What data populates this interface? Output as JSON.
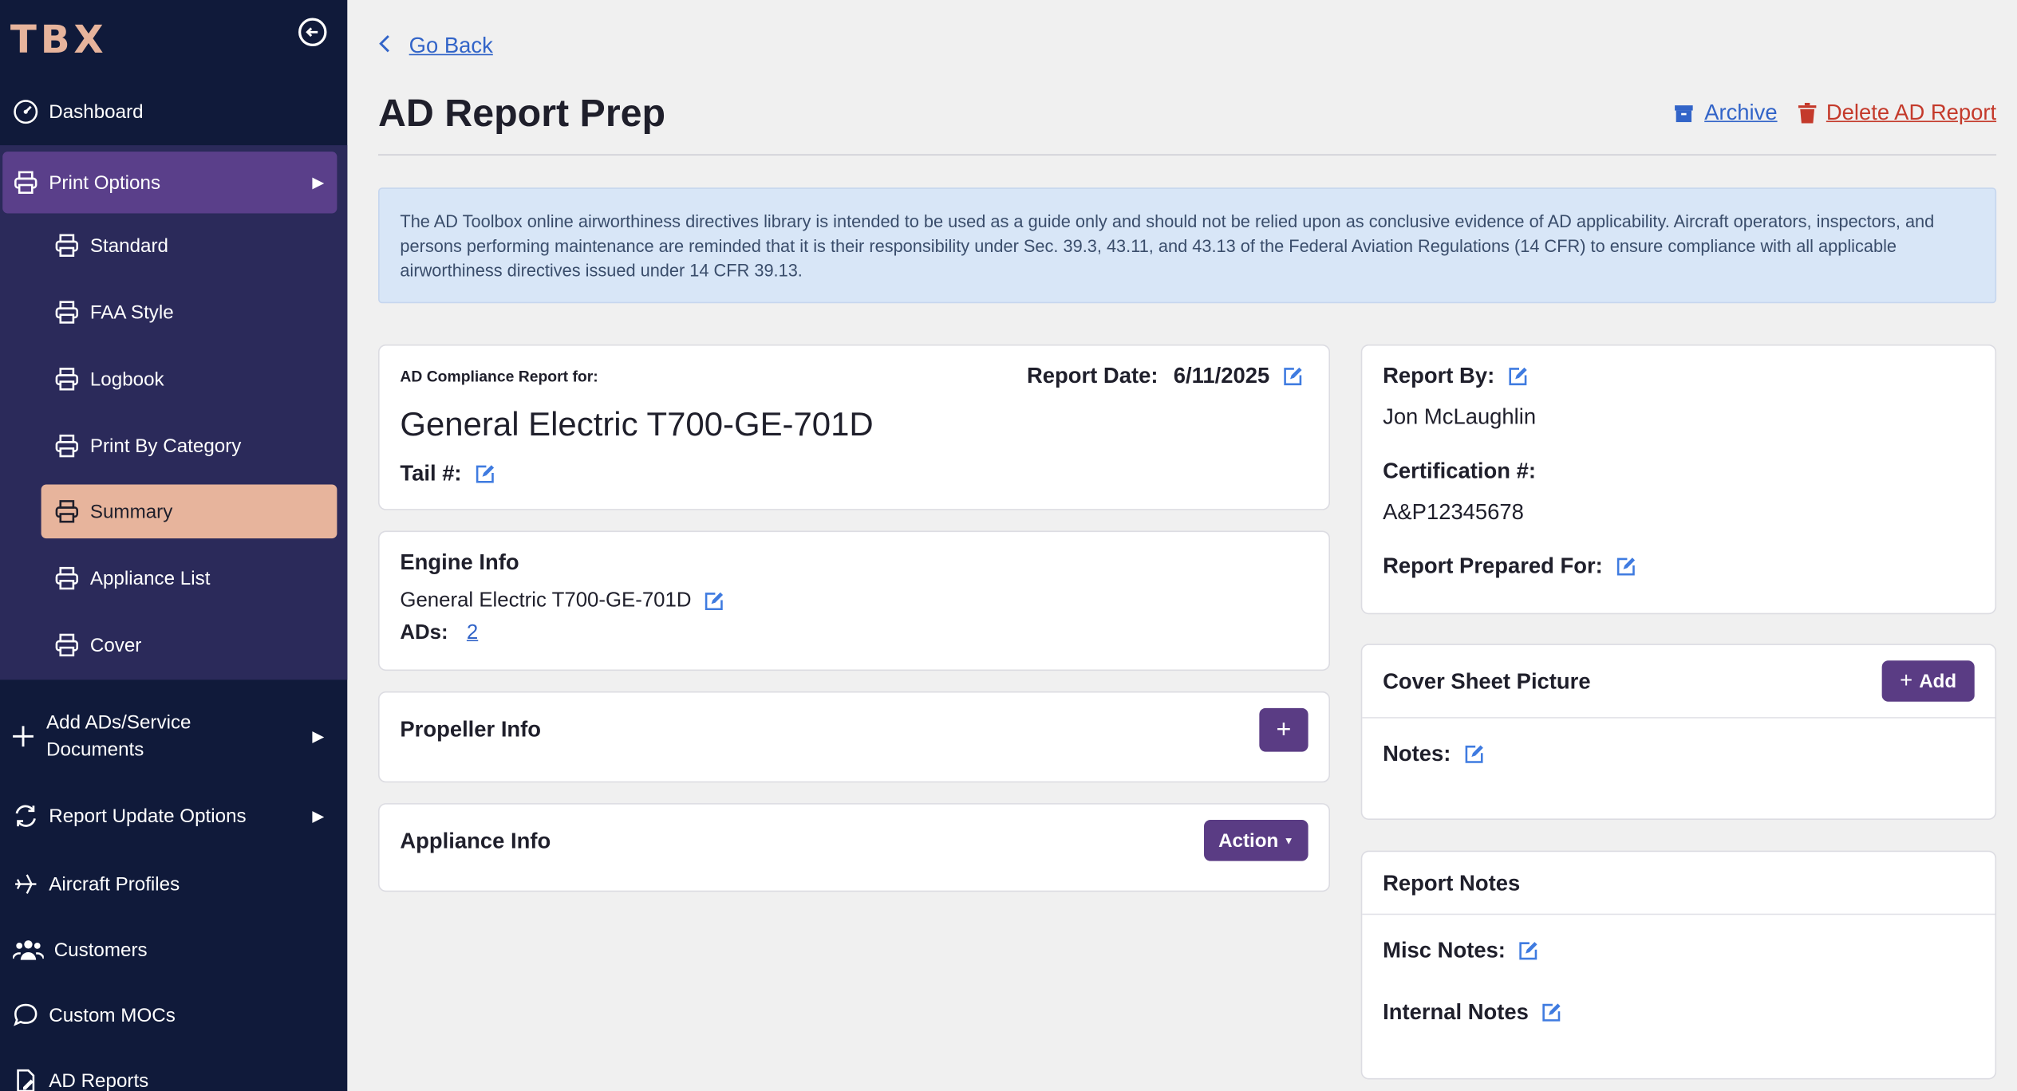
{
  "sidebar": {
    "logo": "TBX",
    "collapse_icon": "arrow-left-circle-icon",
    "dashboard": "Dashboard",
    "print_options": "Print Options",
    "print_sub": [
      "Standard",
      "FAA Style",
      "Logbook",
      "Print By Category",
      "Summary",
      "Appliance List",
      "Cover"
    ],
    "add_ads_1": "Add ADs/Service",
    "add_ads_2": "Documents",
    "report_update": "Report Update Options",
    "aircraft_profiles": "Aircraft Profiles",
    "customers": "Customers",
    "custom_mocs": "Custom MOCs",
    "ad_reports": "AD Reports"
  },
  "header": {
    "go_back": "Go Back",
    "title": "AD Report Prep",
    "archive": "Archive",
    "delete": "Delete AD Report"
  },
  "disclaimer": "The AD Toolbox online airworthiness directives library is intended to be used as a guide only and should not be relied upon as conclusive evidence of AD applicability. Aircraft operators, inspectors, and persons performing maintenance are reminded that it is their responsibility under Sec. 39.3, 43.11, and 43.13 of the Federal Aviation Regulations (14 CFR) to ensure compliance with all applicable airworthiness directives issued under 14 CFR 39.13.",
  "report": {
    "compliance_label": "AD Compliance Report for:",
    "date_label": "Report Date:",
    "date_value": "6/11/2025",
    "engine_model": "General Electric T700-GE-701D",
    "tail_label": "Tail #:"
  },
  "engine": {
    "title": "Engine Info",
    "model": "General Electric T700-GE-701D",
    "ads_label": "ADs:",
    "ads_count": "2"
  },
  "propeller": {
    "title": "Propeller Info",
    "add_symbol": "+"
  },
  "appliance": {
    "title": "Appliance Info",
    "action_label": "Action"
  },
  "report_by": {
    "label": "Report By:",
    "name": "Jon McLaughlin",
    "cert_label": "Certification #:",
    "cert_value": "A&P12345678",
    "prepared_for_label": "Report Prepared For:"
  },
  "cover_sheet": {
    "title": "Cover Sheet Picture",
    "add_label": "Add",
    "notes_label": "Notes:"
  },
  "report_notes": {
    "title": "Report Notes",
    "misc_label": "Misc Notes:",
    "internal_label": "Internal Notes"
  },
  "colors": {
    "sidebar": "#101a3a",
    "accent_purple": "#5a3c84",
    "active_peach": "#e7b49c",
    "link_blue": "#3264c8",
    "danger_red": "#c43a2b"
  }
}
